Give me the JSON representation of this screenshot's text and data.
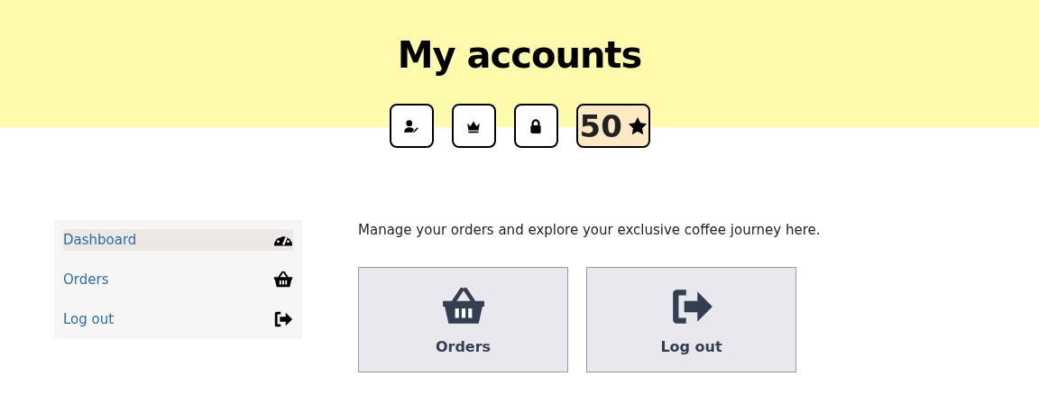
{
  "header": {
    "title": "My accounts",
    "badges": [
      {
        "kind": "user-edit"
      },
      {
        "kind": "crown"
      },
      {
        "kind": "lock"
      },
      {
        "kind": "points",
        "value": "50"
      }
    ]
  },
  "sidebar": {
    "items": [
      {
        "label": "Dashboard",
        "kind": "gauge",
        "selected": true
      },
      {
        "label": "Orders",
        "kind": "basket",
        "selected": false
      },
      {
        "label": "Log out",
        "kind": "logout",
        "selected": false
      }
    ]
  },
  "intro": "Manage your orders and explore your exclusive coffee journey here.",
  "cards": [
    {
      "label": "Orders",
      "kind": "basket"
    },
    {
      "label": "Log out",
      "kind": "logout"
    }
  ]
}
